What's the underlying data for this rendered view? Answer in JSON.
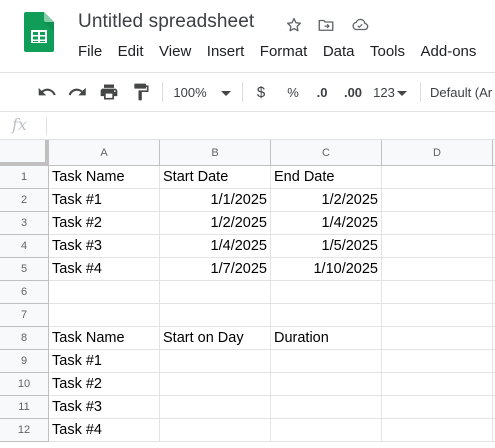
{
  "app": {
    "title": "Untitled spreadsheet",
    "menu": [
      "File",
      "Edit",
      "View",
      "Insert",
      "Format",
      "Data",
      "Tools",
      "Add-ons"
    ]
  },
  "toolbar": {
    "zoom": "100%",
    "currency": "$",
    "percent": "%",
    "decrease_decimal": ".0",
    "increase_decimal": ".00",
    "more_formats": "123",
    "font": "Default (Ar"
  },
  "formula_bar": {
    "fx_label": "fx",
    "value": ""
  },
  "grid": {
    "columns": [
      "A",
      "B",
      "C",
      "D"
    ],
    "rows": [
      {
        "n": "1",
        "a": "Task Name",
        "b": "Start Date",
        "c": "End Date",
        "d": ""
      },
      {
        "n": "2",
        "a": "Task #1",
        "b": "1/1/2025",
        "c": "1/2/2025",
        "d": ""
      },
      {
        "n": "3",
        "a": "Task #2",
        "b": "1/2/2025",
        "c": "1/4/2025",
        "d": ""
      },
      {
        "n": "4",
        "a": "Task #3",
        "b": "1/4/2025",
        "c": "1/5/2025",
        "d": ""
      },
      {
        "n": "5",
        "a": "Task #4",
        "b": "1/7/2025",
        "c": "1/10/2025",
        "d": ""
      },
      {
        "n": "6",
        "a": "",
        "b": "",
        "c": "",
        "d": ""
      },
      {
        "n": "7",
        "a": "",
        "b": "",
        "c": "",
        "d": ""
      },
      {
        "n": "8",
        "a": "Task Name",
        "b": "Start on Day",
        "c": "Duration",
        "d": ""
      },
      {
        "n": "9",
        "a": "Task #1",
        "b": "",
        "c": "",
        "d": ""
      },
      {
        "n": "10",
        "a": "Task #2",
        "b": "",
        "c": "",
        "d": ""
      },
      {
        "n": "11",
        "a": "Task #3",
        "b": "",
        "c": "",
        "d": ""
      },
      {
        "n": "12",
        "a": "Task #4",
        "b": "",
        "c": "",
        "d": ""
      }
    ]
  },
  "colors": {
    "sheets_green": "#0f9d58",
    "selection_blue": "#1a73e8",
    "header_bg": "#f8f9fa",
    "gridline": "#e2e3e3"
  }
}
